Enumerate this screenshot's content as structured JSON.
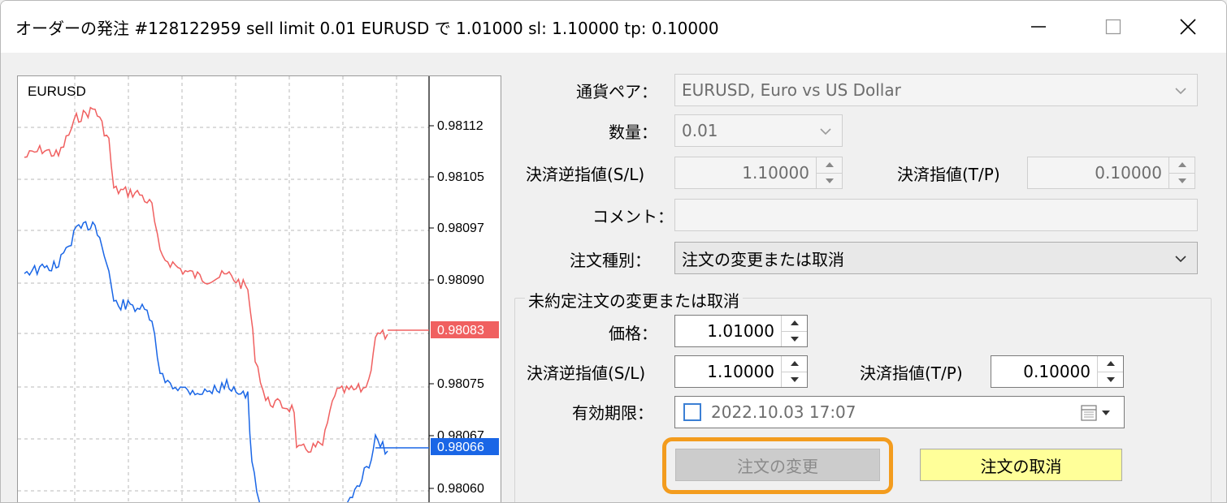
{
  "window": {
    "title": "オーダーの発注 #128122959 sell limit 0.01 EURUSD で 1.01000 sl: 1.10000 tp: 0.10000"
  },
  "chart": {
    "symbol": "EURUSD",
    "price_labels": [
      "0.98112",
      "0.98105",
      "0.98097",
      "0.98090",
      "0.98083",
      "0.98075",
      "0.98067",
      "0.98066",
      "0.98060"
    ],
    "ask_price": "0.98083",
    "bid_price": "0.98066",
    "ask_color": "#f06060",
    "bid_color": "#1a66e6"
  },
  "form": {
    "currency_pair_label": "通貨ペア：",
    "currency_pair_value": "EURUSD, Euro vs US Dollar",
    "volume_label": "数量：",
    "volume_value": "0.01",
    "sl_label": "決済逆指値(S/L)",
    "sl_value": "1.10000",
    "tp_label": "決済指値(T/P)",
    "tp_value": "0.10000",
    "comment_label": "コメント：",
    "comment_value": "",
    "order_type_label": "注文種別：",
    "order_type_value": "注文の変更または取消"
  },
  "group": {
    "title": "未約定注文の変更または取消",
    "price_label": "価格：",
    "price_value": "1.01000",
    "sl_label": "決済逆指値(S/L)",
    "sl_value": "1.10000",
    "tp_label": "決済指値(T/P)",
    "tp_value": "0.10000",
    "expiry_label": "有効期限：",
    "expiry_value": "2022.10.03 17:07",
    "modify_button": "注文の変更",
    "cancel_button": "注文の取消"
  },
  "colors": {
    "highlight": "#f39c1e",
    "cancel_button_bg": "#ffff99"
  }
}
